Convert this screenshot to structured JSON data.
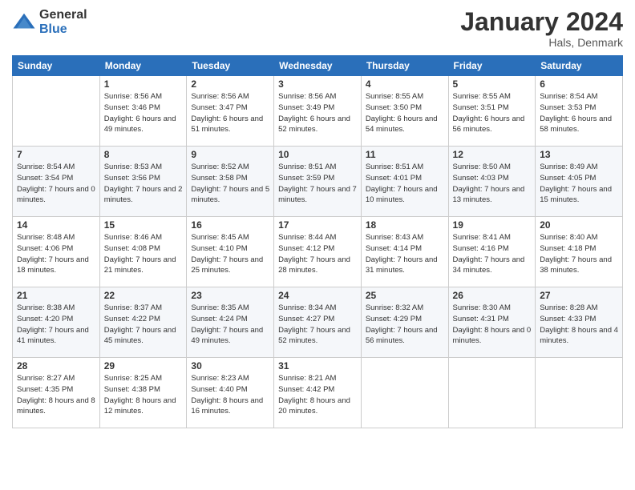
{
  "logo": {
    "general": "General",
    "blue": "Blue"
  },
  "title": "January 2024",
  "location": "Hals, Denmark",
  "days_header": [
    "Sunday",
    "Monday",
    "Tuesday",
    "Wednesday",
    "Thursday",
    "Friday",
    "Saturday"
  ],
  "weeks": [
    [
      {
        "num": "",
        "sunrise": "",
        "sunset": "",
        "daylight": ""
      },
      {
        "num": "1",
        "sunrise": "Sunrise: 8:56 AM",
        "sunset": "Sunset: 3:46 PM",
        "daylight": "Daylight: 6 hours and 49 minutes."
      },
      {
        "num": "2",
        "sunrise": "Sunrise: 8:56 AM",
        "sunset": "Sunset: 3:47 PM",
        "daylight": "Daylight: 6 hours and 51 minutes."
      },
      {
        "num": "3",
        "sunrise": "Sunrise: 8:56 AM",
        "sunset": "Sunset: 3:49 PM",
        "daylight": "Daylight: 6 hours and 52 minutes."
      },
      {
        "num": "4",
        "sunrise": "Sunrise: 8:55 AM",
        "sunset": "Sunset: 3:50 PM",
        "daylight": "Daylight: 6 hours and 54 minutes."
      },
      {
        "num": "5",
        "sunrise": "Sunrise: 8:55 AM",
        "sunset": "Sunset: 3:51 PM",
        "daylight": "Daylight: 6 hours and 56 minutes."
      },
      {
        "num": "6",
        "sunrise": "Sunrise: 8:54 AM",
        "sunset": "Sunset: 3:53 PM",
        "daylight": "Daylight: 6 hours and 58 minutes."
      }
    ],
    [
      {
        "num": "7",
        "sunrise": "Sunrise: 8:54 AM",
        "sunset": "Sunset: 3:54 PM",
        "daylight": "Daylight: 7 hours and 0 minutes."
      },
      {
        "num": "8",
        "sunrise": "Sunrise: 8:53 AM",
        "sunset": "Sunset: 3:56 PM",
        "daylight": "Daylight: 7 hours and 2 minutes."
      },
      {
        "num": "9",
        "sunrise": "Sunrise: 8:52 AM",
        "sunset": "Sunset: 3:58 PM",
        "daylight": "Daylight: 7 hours and 5 minutes."
      },
      {
        "num": "10",
        "sunrise": "Sunrise: 8:51 AM",
        "sunset": "Sunset: 3:59 PM",
        "daylight": "Daylight: 7 hours and 7 minutes."
      },
      {
        "num": "11",
        "sunrise": "Sunrise: 8:51 AM",
        "sunset": "Sunset: 4:01 PM",
        "daylight": "Daylight: 7 hours and 10 minutes."
      },
      {
        "num": "12",
        "sunrise": "Sunrise: 8:50 AM",
        "sunset": "Sunset: 4:03 PM",
        "daylight": "Daylight: 7 hours and 13 minutes."
      },
      {
        "num": "13",
        "sunrise": "Sunrise: 8:49 AM",
        "sunset": "Sunset: 4:05 PM",
        "daylight": "Daylight: 7 hours and 15 minutes."
      }
    ],
    [
      {
        "num": "14",
        "sunrise": "Sunrise: 8:48 AM",
        "sunset": "Sunset: 4:06 PM",
        "daylight": "Daylight: 7 hours and 18 minutes."
      },
      {
        "num": "15",
        "sunrise": "Sunrise: 8:46 AM",
        "sunset": "Sunset: 4:08 PM",
        "daylight": "Daylight: 7 hours and 21 minutes."
      },
      {
        "num": "16",
        "sunrise": "Sunrise: 8:45 AM",
        "sunset": "Sunset: 4:10 PM",
        "daylight": "Daylight: 7 hours and 25 minutes."
      },
      {
        "num": "17",
        "sunrise": "Sunrise: 8:44 AM",
        "sunset": "Sunset: 4:12 PM",
        "daylight": "Daylight: 7 hours and 28 minutes."
      },
      {
        "num": "18",
        "sunrise": "Sunrise: 8:43 AM",
        "sunset": "Sunset: 4:14 PM",
        "daylight": "Daylight: 7 hours and 31 minutes."
      },
      {
        "num": "19",
        "sunrise": "Sunrise: 8:41 AM",
        "sunset": "Sunset: 4:16 PM",
        "daylight": "Daylight: 7 hours and 34 minutes."
      },
      {
        "num": "20",
        "sunrise": "Sunrise: 8:40 AM",
        "sunset": "Sunset: 4:18 PM",
        "daylight": "Daylight: 7 hours and 38 minutes."
      }
    ],
    [
      {
        "num": "21",
        "sunrise": "Sunrise: 8:38 AM",
        "sunset": "Sunset: 4:20 PM",
        "daylight": "Daylight: 7 hours and 41 minutes."
      },
      {
        "num": "22",
        "sunrise": "Sunrise: 8:37 AM",
        "sunset": "Sunset: 4:22 PM",
        "daylight": "Daylight: 7 hours and 45 minutes."
      },
      {
        "num": "23",
        "sunrise": "Sunrise: 8:35 AM",
        "sunset": "Sunset: 4:24 PM",
        "daylight": "Daylight: 7 hours and 49 minutes."
      },
      {
        "num": "24",
        "sunrise": "Sunrise: 8:34 AM",
        "sunset": "Sunset: 4:27 PM",
        "daylight": "Daylight: 7 hours and 52 minutes."
      },
      {
        "num": "25",
        "sunrise": "Sunrise: 8:32 AM",
        "sunset": "Sunset: 4:29 PM",
        "daylight": "Daylight: 7 hours and 56 minutes."
      },
      {
        "num": "26",
        "sunrise": "Sunrise: 8:30 AM",
        "sunset": "Sunset: 4:31 PM",
        "daylight": "Daylight: 8 hours and 0 minutes."
      },
      {
        "num": "27",
        "sunrise": "Sunrise: 8:28 AM",
        "sunset": "Sunset: 4:33 PM",
        "daylight": "Daylight: 8 hours and 4 minutes."
      }
    ],
    [
      {
        "num": "28",
        "sunrise": "Sunrise: 8:27 AM",
        "sunset": "Sunset: 4:35 PM",
        "daylight": "Daylight: 8 hours and 8 minutes."
      },
      {
        "num": "29",
        "sunrise": "Sunrise: 8:25 AM",
        "sunset": "Sunset: 4:38 PM",
        "daylight": "Daylight: 8 hours and 12 minutes."
      },
      {
        "num": "30",
        "sunrise": "Sunrise: 8:23 AM",
        "sunset": "Sunset: 4:40 PM",
        "daylight": "Daylight: 8 hours and 16 minutes."
      },
      {
        "num": "31",
        "sunrise": "Sunrise: 8:21 AM",
        "sunset": "Sunset: 4:42 PM",
        "daylight": "Daylight: 8 hours and 20 minutes."
      },
      {
        "num": "",
        "sunrise": "",
        "sunset": "",
        "daylight": ""
      },
      {
        "num": "",
        "sunrise": "",
        "sunset": "",
        "daylight": ""
      },
      {
        "num": "",
        "sunrise": "",
        "sunset": "",
        "daylight": ""
      }
    ]
  ]
}
